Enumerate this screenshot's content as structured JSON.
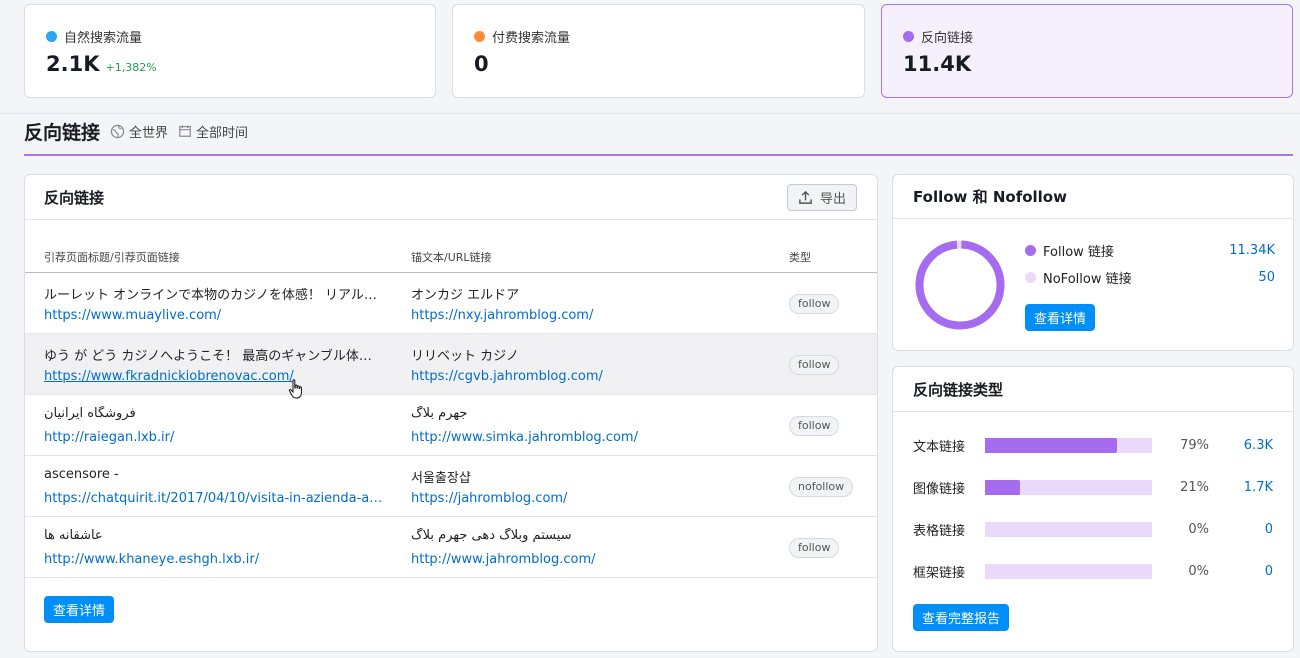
{
  "metrics": [
    {
      "label": "自然搜索流量",
      "value": "2.1K",
      "delta": "+1,382%",
      "color": "#2aa6f0"
    },
    {
      "label": "付费搜索流量",
      "value": "0",
      "delta": "",
      "color": "#ff8c3c"
    },
    {
      "label": "反向链接",
      "value": "11.4K",
      "delta": "",
      "color": "#a56cf0"
    }
  ],
  "section": {
    "title": "反向链接",
    "region": "全世界",
    "period": "全部时间"
  },
  "backlinks": {
    "title": "反向链接",
    "export_label": "导出",
    "columns": [
      "引荐页面标题/引荐页面链接",
      "锚文本/URL链接",
      "类型"
    ],
    "rows": [
      {
        "title": "ルーレット オンラインで本物のカジノを体感！ リアル…",
        "url": "https://www.muaylive.com/",
        "anchor": "オンカジ エルドア",
        "target": "https://nxy.jahromblog.com/",
        "type": "follow"
      },
      {
        "title": "ゆう が どう カジノへようこそ！ 最高のギャンブル体…",
        "url": "https://www.fkradnickiobrenovac.com/",
        "anchor": "リリベット カジノ",
        "target": "https://cgvb.jahromblog.com/",
        "type": "follow"
      },
      {
        "title": "فروشگاه ایرانیان",
        "url": "http://raiegan.lxb.ir/",
        "anchor": "جهرم بلاگ",
        "target": "http://www.simka.jahromblog.com/",
        "type": "follow"
      },
      {
        "title": "ascensore -",
        "url": "https://chatquirit.it/2017/04/10/visita-in-azienda-a…",
        "anchor": "서울출장샵",
        "target": "https://jahromblog.com/",
        "type": "nofollow"
      },
      {
        "title": "عاشقانه ها",
        "url": "http://www.khaneye.eshgh.lxb.ir/",
        "anchor": "سیستم وبلاگ دهی جهرم بلاگ",
        "target": "http://www.jahromblog.com/",
        "type": "follow"
      }
    ],
    "details_label": "查看详情"
  },
  "follow": {
    "title": "Follow 和 Nofollow",
    "items": [
      {
        "label": "Follow 链接",
        "value": "11.34K",
        "color": "#a56cf0"
      },
      {
        "label": "NoFollow 链接",
        "value": "50",
        "color": "#ead9fb"
      }
    ],
    "follow_fraction": 0.9956,
    "details_label": "查看详情"
  },
  "types": {
    "title": "反向链接类型",
    "items": [
      {
        "label": "文本链接",
        "pct": "79%",
        "count": "6.3K",
        "fraction": 0.79
      },
      {
        "label": "图像链接",
        "pct": "21%",
        "count": "1.7K",
        "fraction": 0.21
      },
      {
        "label": "表格链接",
        "pct": "0%",
        "count": "0",
        "fraction": 0
      },
      {
        "label": "框架链接",
        "pct": "0%",
        "count": "0",
        "fraction": 0
      }
    ],
    "report_label": "查看完整报告"
  }
}
